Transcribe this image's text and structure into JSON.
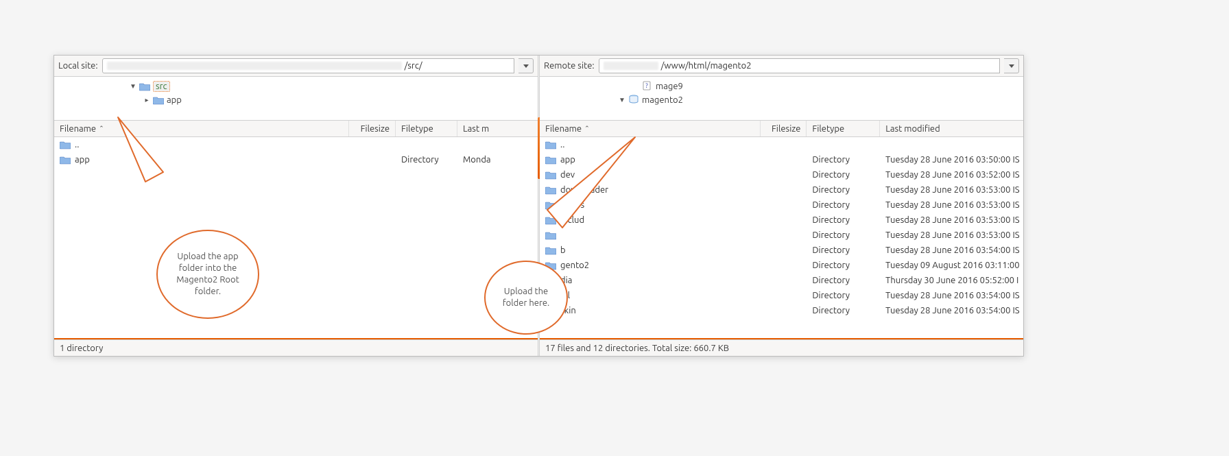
{
  "local": {
    "label": "Local site:",
    "path": "/src/",
    "tree": [
      {
        "indent": 110,
        "twisty": "▼",
        "label": "src",
        "selected": true,
        "icon": "folder"
      },
      {
        "indent": 130,
        "twisty": "▸",
        "label": "app",
        "selected": false,
        "icon": "folder"
      }
    ],
    "columns": {
      "filename": "Filename",
      "filesize": "Filesize",
      "filetype": "Filetype",
      "lastmod": "Last m"
    },
    "rows": [
      {
        "name": "..",
        "icon": "folder",
        "filetype": "",
        "lastmod": ""
      },
      {
        "name": "app",
        "icon": "folder",
        "filetype": "Directory",
        "lastmod": "Monda"
      }
    ],
    "status": "1 directory",
    "callout": "Upload the app folder into the Magento2 Root folder."
  },
  "remote": {
    "label": "Remote site:",
    "path": "/www/html/magento2",
    "tree": [
      {
        "indent": 135,
        "twisty": "",
        "label": "mage9",
        "selected": false,
        "icon": "unknown"
      },
      {
        "indent": 115,
        "twisty": "▼",
        "label": "magento2",
        "selected": false,
        "icon": "drive"
      }
    ],
    "columns": {
      "filename": "Filename",
      "filesize": "Filesize",
      "filetype": "Filetype",
      "lastmod": "Last modified"
    },
    "rows": [
      {
        "name": "..",
        "icon": "folder",
        "filetype": "",
        "lastmod": ""
      },
      {
        "name": "app",
        "icon": "folder",
        "filetype": "Directory",
        "lastmod": "Tuesday 28 June 2016 03:50:00 IS"
      },
      {
        "name": "dev",
        "icon": "folder",
        "filetype": "Directory",
        "lastmod": "Tuesday 28 June 2016 03:52:00 IS"
      },
      {
        "name": "downloader",
        "icon": "folder",
        "filetype": "Directory",
        "lastmod": "Tuesday 28 June 2016 03:53:00 IS"
      },
      {
        "name": "errors",
        "icon": "folder",
        "filetype": "Directory",
        "lastmod": "Tuesday 28 June 2016 03:53:00 IS"
      },
      {
        "name": "includ",
        "icon": "folder",
        "filetype": "Directory",
        "lastmod": "Tuesday 28 June 2016 03:53:00 IS"
      },
      {
        "name": "",
        "icon": "folder",
        "filetype": "Directory",
        "lastmod": "Tuesday 28 June 2016 03:53:00 IS"
      },
      {
        "name": "b",
        "icon": "folder",
        "filetype": "Directory",
        "lastmod": "Tuesday 28 June 2016 03:54:00 IS"
      },
      {
        "name": "gento2",
        "icon": "folder",
        "filetype": "Directory",
        "lastmod": "Tuesday 09 August 2016 03:11:00"
      },
      {
        "name": "dia",
        "icon": "folder",
        "filetype": "Directory",
        "lastmod": "Thursday 30 June 2016 05:52:00 I"
      },
      {
        "name": "ell",
        "icon": "folder",
        "filetype": "Directory",
        "lastmod": "Tuesday 28 June 2016 03:54:00 IS"
      },
      {
        "name": "skin",
        "icon": "folder",
        "filetype": "Directory",
        "lastmod": "Tuesday 28 June 2016 03:54:00 IS"
      }
    ],
    "status": "17 files and 12 directories. Total size: 660.7 KB",
    "callout": "Upload the folder here."
  }
}
